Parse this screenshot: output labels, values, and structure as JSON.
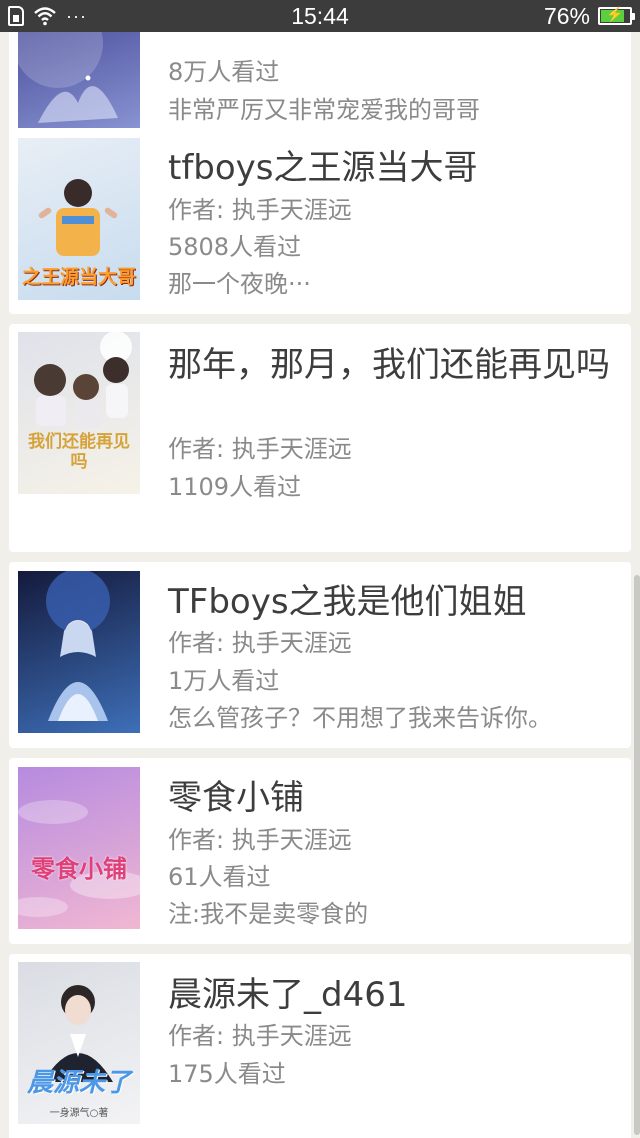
{
  "status_bar": {
    "icons": [
      "sim-icon",
      "wifi-icon",
      "more-dots-icon"
    ],
    "more_dots": "···",
    "time": "15:44",
    "battery_percent": "76%",
    "battery_level": 0.76,
    "battery_color": "#5ccf3e",
    "charging_symbol": "⚡"
  },
  "books": [
    {
      "title": "",
      "author": "",
      "views": "8万人看过",
      "description": "非常严厉又非常宠爱我的哥哥",
      "cover_text": "",
      "cover_colors": [
        "#3a3b8c",
        "#8f9bd8"
      ]
    },
    {
      "title": "tfboys之王源当大哥",
      "author": "作者: 执手天涯远",
      "views": "5808人看过",
      "description": "那一个夜晚···",
      "cover_text": "之王源当大哥",
      "cover_colors": [
        "#e8eef5",
        "#c7dcef"
      ]
    },
    {
      "title": "那年，那月，我们还能再见吗",
      "author": "作者: 执手天涯远",
      "views": "1109人看过",
      "description": "",
      "cover_text": "我们还能再见吗",
      "cover_colors": [
        "#dfe2ea",
        "#f6f2e8"
      ]
    },
    {
      "title": "TFboys之我是他们姐姐",
      "author": "作者: 执手天涯远",
      "views": "1万人看过",
      "description": "怎么管孩子？不用想了我来告诉你。",
      "cover_text": "",
      "cover_colors": [
        "#141a3c",
        "#3e6fb8"
      ]
    },
    {
      "title": "零食小铺",
      "author": "作者: 执手天涯远",
      "views": "61人看过",
      "description": "注:我不是卖零食的",
      "cover_text": "零食小铺",
      "cover_colors": [
        "#b68be0",
        "#f1b7d2"
      ]
    },
    {
      "title": "晨源未了_d461",
      "author": "作者: 执手天涯远",
      "views": "175人看过",
      "description": "",
      "cover_text": "晨源未了",
      "cover_subtext": "一身源气○著",
      "cover_colors": [
        "#d9dde3",
        "#f3f3f5"
      ]
    }
  ]
}
